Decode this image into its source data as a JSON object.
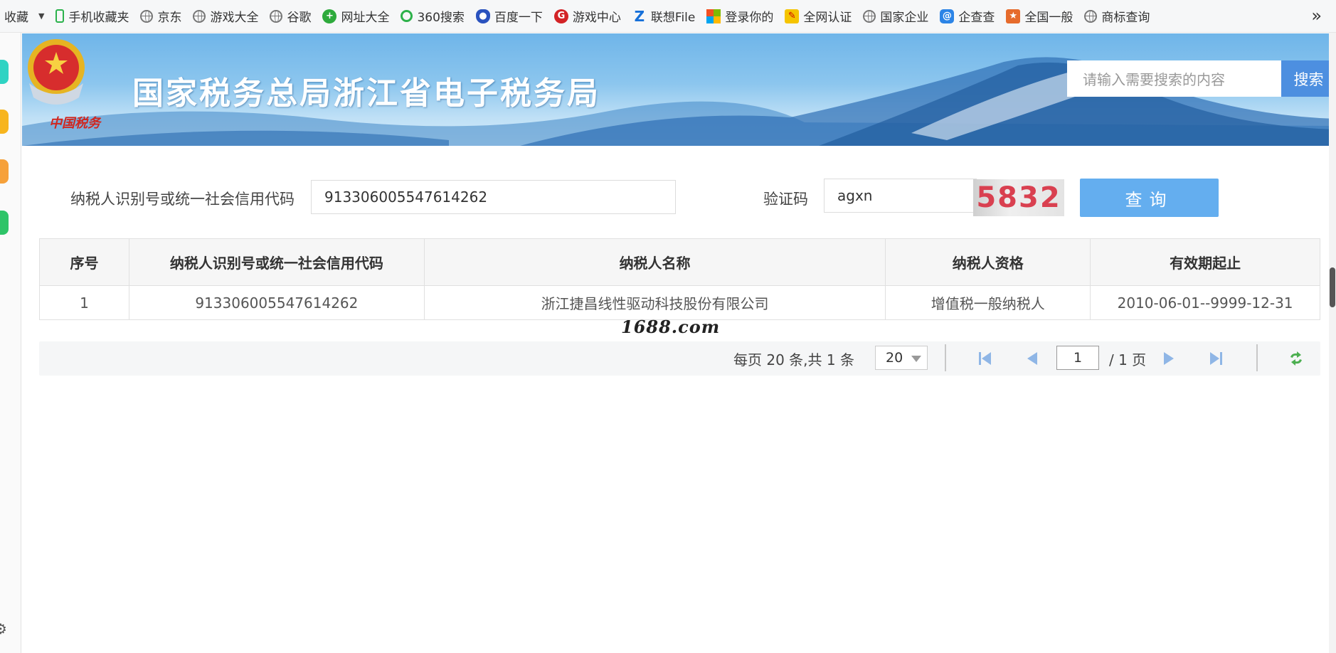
{
  "bookmarks": {
    "favorites_label": "收藏",
    "items": [
      {
        "label": "手机收藏夹",
        "icon": "phone-icon"
      },
      {
        "label": "京东",
        "icon": "globe-icon"
      },
      {
        "label": "游戏大全",
        "icon": "globe-icon"
      },
      {
        "label": "谷歌",
        "icon": "globe-icon"
      },
      {
        "label": "网址大全",
        "icon": "plus-circle-icon"
      },
      {
        "label": "360搜索",
        "icon": "ring-icon"
      },
      {
        "label": "百度一下",
        "icon": "paw-icon"
      },
      {
        "label": "游戏中心",
        "icon": "game-icon"
      },
      {
        "label": "联想File",
        "icon": "z-icon"
      },
      {
        "label": "登录你的",
        "icon": "microsoft-icon"
      },
      {
        "label": "全网认证",
        "icon": "pen-icon"
      },
      {
        "label": "国家企业",
        "icon": "globe-icon"
      },
      {
        "label": "企查查",
        "icon": "at-icon"
      },
      {
        "label": "全国一般",
        "icon": "stamp-icon"
      },
      {
        "label": "商标查询",
        "icon": "globe-icon"
      }
    ],
    "more": "»"
  },
  "banner": {
    "title": "国家税务总局浙江省电子税务局",
    "emblem_script": "中国税务",
    "search_placeholder": "请输入需要搜索的内容",
    "search_button": "搜索"
  },
  "query": {
    "taxpayer_id_label": "纳税人识别号或统一社会信用代码",
    "taxpayer_id_value": "913306005547614262",
    "captcha_label": "验证码",
    "captcha_value": "agxn",
    "captcha_image_text": "5832",
    "query_button": "查询"
  },
  "table": {
    "headers": [
      "序号",
      "纳税人识别号或统一社会信用代码",
      "纳税人名称",
      "纳税人资格",
      "有效期起止"
    ],
    "rows": [
      [
        "1",
        "913306005547614262",
        "浙江捷昌线性驱动科技股份有限公司",
        "增值税一般纳税人",
        "2010-06-01--9999-12-31"
      ]
    ]
  },
  "watermark": "1688.com",
  "pagination": {
    "summary": "每页 20 条,共 1 条",
    "page_size": "20",
    "current_page": "1",
    "total_pages": "/ 1 页"
  },
  "colors": {
    "query_button": "#64aeef",
    "search_button": "#4d8fe0",
    "captcha_text": "#d94050"
  }
}
